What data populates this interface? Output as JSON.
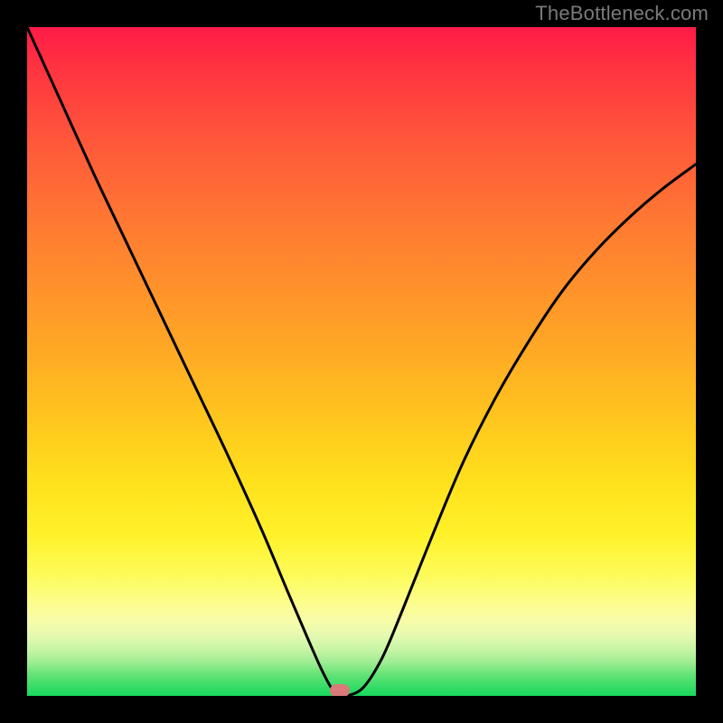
{
  "watermark": "TheBottleneck.com",
  "marker": {
    "color": "#d97a7a",
    "x_frac": 0.468,
    "y_frac": 0.992
  },
  "chart_data": {
    "type": "line",
    "title": "",
    "xlabel": "",
    "ylabel": "",
    "xlim": [
      0,
      1
    ],
    "ylim": [
      0,
      1
    ],
    "grid": false,
    "background": "rainbow-vertical-gradient",
    "series": [
      {
        "name": "bottleneck-curve",
        "color": "#000000",
        "x": [
          0.0,
          0.05,
          0.1,
          0.15,
          0.2,
          0.25,
          0.3,
          0.35,
          0.39,
          0.42,
          0.44,
          0.455,
          0.468,
          0.5,
          0.53,
          0.56,
          0.6,
          0.65,
          0.7,
          0.75,
          0.8,
          0.85,
          0.9,
          0.95,
          1.0
        ],
        "y": [
          1.0,
          0.89,
          0.78,
          0.675,
          0.57,
          0.465,
          0.36,
          0.25,
          0.155,
          0.085,
          0.04,
          0.012,
          0.0,
          0.01,
          0.055,
          0.125,
          0.225,
          0.345,
          0.445,
          0.53,
          0.605,
          0.665,
          0.715,
          0.758,
          0.795
        ]
      }
    ],
    "annotations": [
      {
        "type": "marker",
        "shape": "rounded-rect",
        "color": "#d97a7a",
        "x": 0.468,
        "y": 0.0
      }
    ]
  }
}
